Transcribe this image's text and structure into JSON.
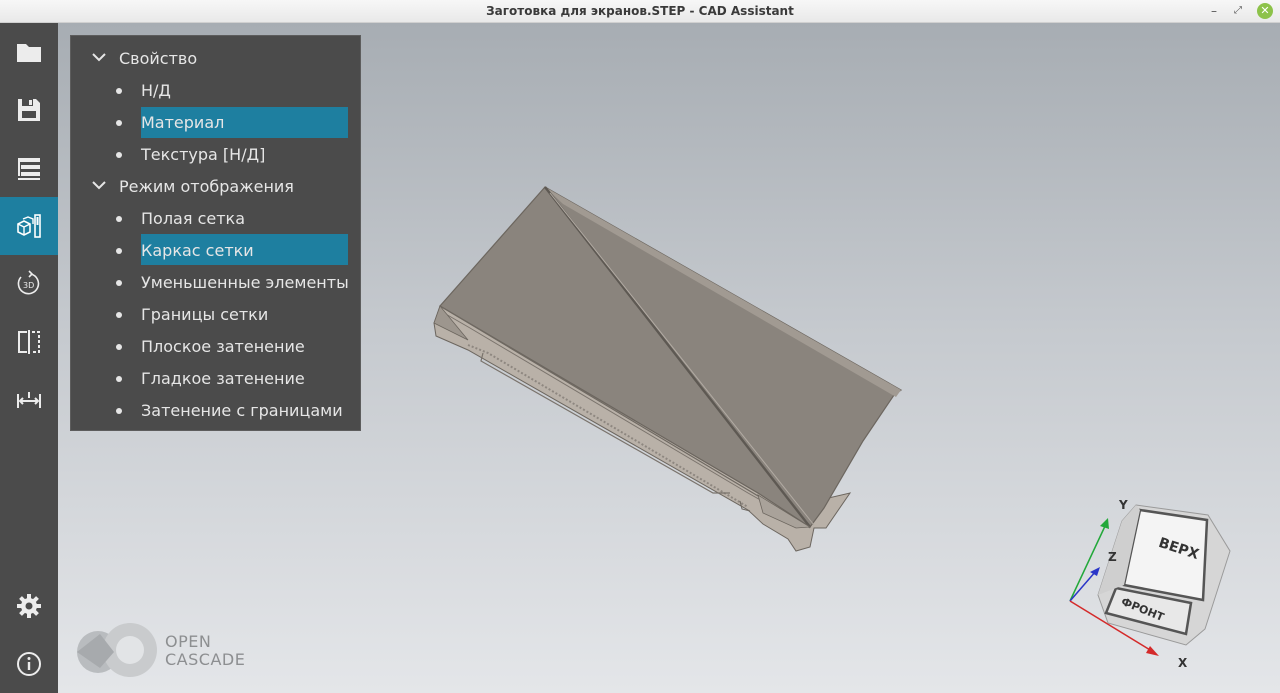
{
  "window": {
    "title": "Заготовка для экранов.STEP - CAD Assistant",
    "min_glyph": "–",
    "max_glyph": "⤢",
    "close_glyph": "✕"
  },
  "sidebar": {
    "items": [
      {
        "name": "open-file",
        "icon": "folder-icon"
      },
      {
        "name": "save-file",
        "icon": "floppy-icon"
      },
      {
        "name": "model-structure",
        "icon": "tree-icon"
      },
      {
        "name": "display-properties",
        "icon": "display-props-icon",
        "active": true
      },
      {
        "name": "view-3d",
        "icon": "3d-rotate-icon",
        "label": "3D"
      },
      {
        "name": "clipping",
        "icon": "clipping-plane-icon"
      },
      {
        "name": "measure",
        "icon": "measure-icon"
      },
      {
        "name": "settings",
        "icon": "gear-icon"
      },
      {
        "name": "about",
        "icon": "info-icon"
      }
    ]
  },
  "panel": {
    "groups": [
      {
        "label": "Свойство",
        "items": [
          {
            "label": "Н/Д",
            "selected": false
          },
          {
            "label": "Материал",
            "selected": true
          },
          {
            "label": "Текстура [Н/Д]",
            "selected": false
          }
        ]
      },
      {
        "label": "Режим отображения",
        "items": [
          {
            "label": "Полая сетка",
            "selected": false
          },
          {
            "label": "Каркас сетки",
            "selected": true
          },
          {
            "label": "Уменьшенные элементы",
            "selected": false
          },
          {
            "label": "Границы сетки",
            "selected": false
          },
          {
            "label": "Плоское затенение",
            "selected": false
          },
          {
            "label": "Гладкое затенение",
            "selected": false
          },
          {
            "label": "Затенение с границами",
            "selected": false
          }
        ]
      }
    ]
  },
  "logo": {
    "line1": "OPEN",
    "line2": "CASCADE"
  },
  "view_cube": {
    "top": "ВЕРХ",
    "front": "ФРОНТ",
    "axis_x": "X",
    "axis_y": "Y",
    "axis_z": "Z"
  },
  "colors": {
    "accent": "#1e7fa0",
    "sidebar": "#4b4b4b",
    "model": "#8a847d"
  }
}
